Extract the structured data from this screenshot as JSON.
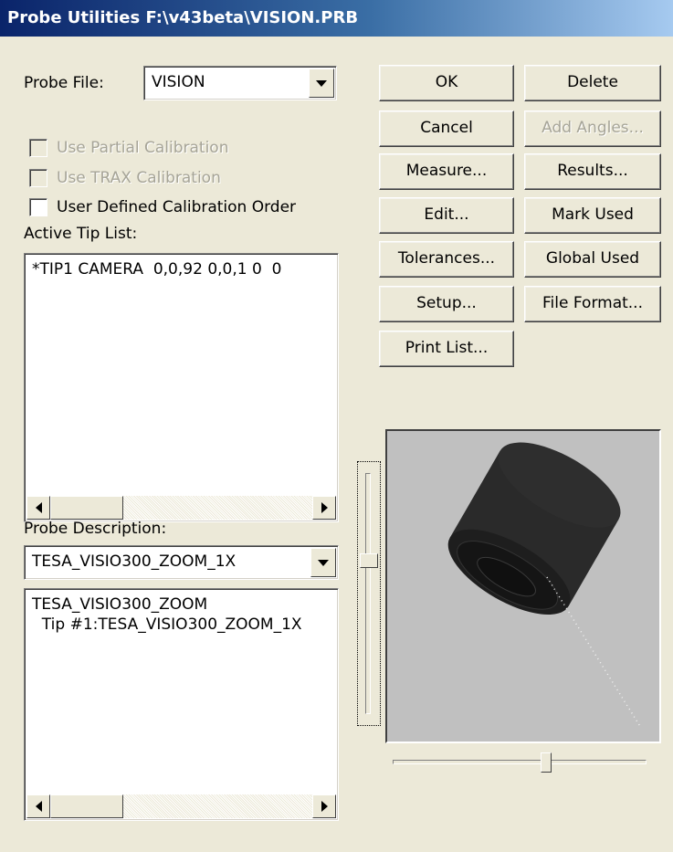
{
  "window": {
    "title": "Probe Utilities  F:\\v43beta\\VISION.PRB"
  },
  "probe_file": {
    "label": "Probe File:",
    "value": "VISION"
  },
  "options": {
    "partial": {
      "label": "Use Partial Calibration",
      "checked": false,
      "enabled": false
    },
    "trax": {
      "label": "Use TRAX Calibration",
      "checked": false,
      "enabled": false
    },
    "order": {
      "label": "User Defined Calibration Order",
      "checked": false,
      "enabled": true
    }
  },
  "tip_list": {
    "label": "Active Tip List:",
    "items": [
      "*TIP1 CAMERA  0,0,92 0,0,1 0  0"
    ]
  },
  "probe_desc": {
    "label": "Probe Description:",
    "value": "TESA_VISIO300_ZOOM_1X",
    "lines": [
      "TESA_VISIO300_ZOOM",
      "  Tip #1:TESA_VISIO300_ZOOM_1X"
    ]
  },
  "buttons": {
    "ok": "OK",
    "delete": "Delete",
    "cancel": "Cancel",
    "add_angles": "Add Angles...",
    "measure": "Measure...",
    "results": "Results...",
    "edit": "Edit...",
    "mark_used": "Mark Used",
    "tolerances": "Tolerances...",
    "global_used": "Global Used",
    "setup": "Setup...",
    "file_format": "File Format...",
    "print_list": "Print List..."
  },
  "colors": {
    "preview_bg": "#c0c0c0",
    "probe_body": "#1e1e1e"
  }
}
